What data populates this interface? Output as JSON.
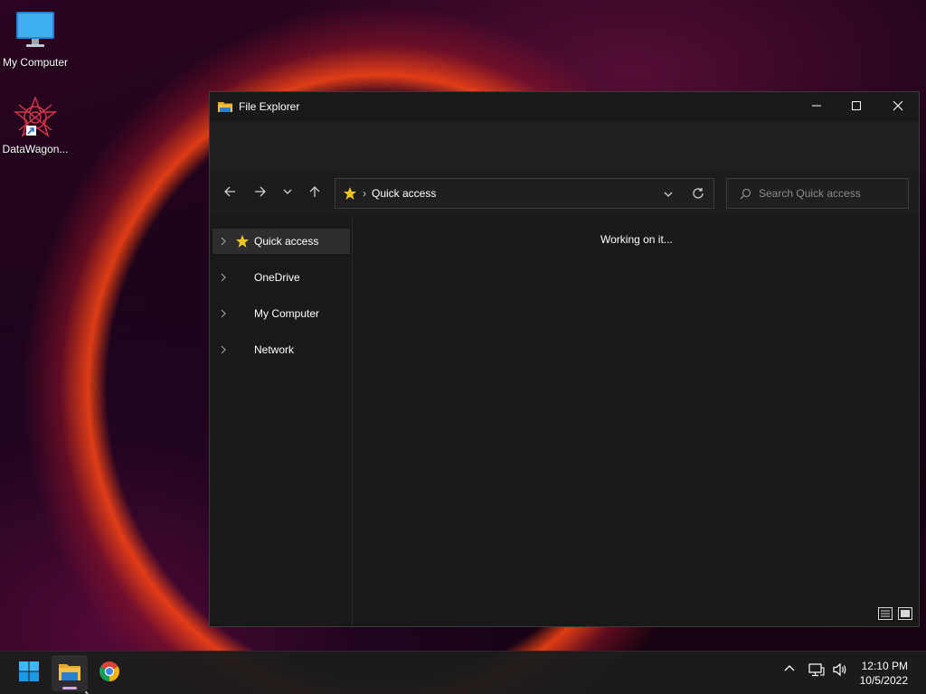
{
  "desktop": {
    "icons": [
      {
        "label": "My Computer",
        "icon": "monitor-icon"
      },
      {
        "label": "DataWagon...",
        "icon": "datawagon-app-icon"
      }
    ]
  },
  "window": {
    "title": "File Explorer",
    "controls": {
      "minimize": "minimize-icon",
      "maximize": "maximize-icon",
      "close": "close-icon"
    },
    "address": {
      "location": "Quick access",
      "icon": "star-icon"
    },
    "search": {
      "placeholder": "Search Quick access"
    },
    "nav_pane": {
      "items": [
        {
          "label": "Quick access",
          "icon": "star-icon",
          "selected": true
        },
        {
          "label": "OneDrive",
          "icon": "",
          "selected": false
        },
        {
          "label": "My Computer",
          "icon": "",
          "selected": false
        },
        {
          "label": "Network",
          "icon": "",
          "selected": false
        }
      ]
    },
    "content": {
      "status_text": "Working on it..."
    }
  },
  "taskbar": {
    "apps": [
      {
        "name": "Start",
        "icon": "windows-start-icon"
      },
      {
        "name": "File Explorer",
        "icon": "folder-icon",
        "active": true
      },
      {
        "name": "Google Chrome",
        "icon": "chrome-icon"
      }
    ],
    "clock": {
      "time": "12:10 PM",
      "date": "10/5/2022"
    }
  },
  "colors": {
    "accent": "#60cdff",
    "folder": "#f5c044",
    "star": "#f5c518"
  }
}
